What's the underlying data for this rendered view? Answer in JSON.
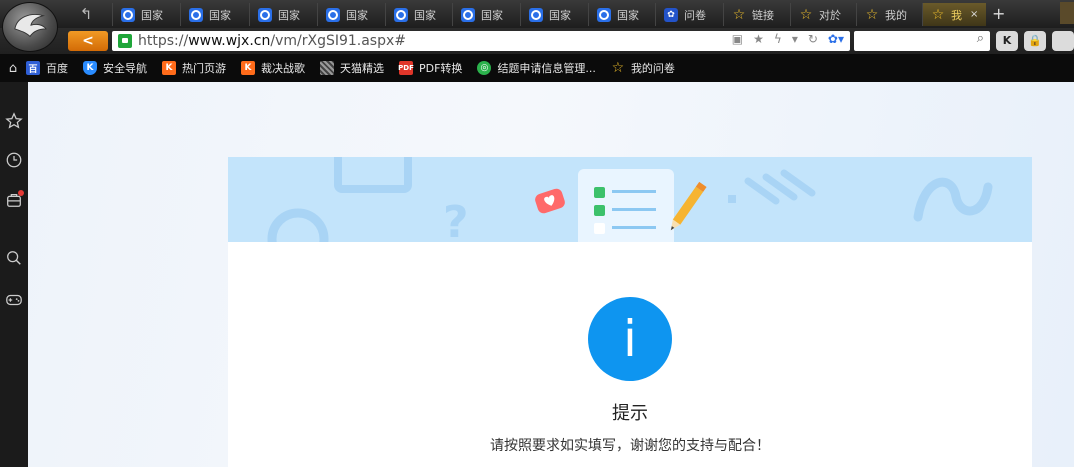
{
  "browser": {
    "tabs": [
      {
        "label": "国家",
        "icon": "blue-eye"
      },
      {
        "label": "国家",
        "icon": "blue-eye"
      },
      {
        "label": "国家",
        "icon": "blue-eye"
      },
      {
        "label": "国家",
        "icon": "blue-eye"
      },
      {
        "label": "国家",
        "icon": "blue-eye"
      },
      {
        "label": "国家",
        "icon": "blue-eye"
      },
      {
        "label": "国家",
        "icon": "blue-eye"
      },
      {
        "label": "国家",
        "icon": "blue-eye"
      },
      {
        "label": "问卷",
        "icon": "paw"
      },
      {
        "label": "链接",
        "icon": "star"
      },
      {
        "label": "对於",
        "icon": "star"
      },
      {
        "label": "我的",
        "icon": "star"
      },
      {
        "label": "我",
        "icon": "star",
        "active": true
      }
    ],
    "active_tab_close": "×",
    "new_tab_label": "+",
    "back_top_glyph": "↰",
    "back_glyph": "<",
    "url_prefix": "https://",
    "url_host": "www.wjx.cn",
    "url_path": "/vm/rXgSI91.aspx#",
    "right_buttons": [
      "K",
      "🔒"
    ]
  },
  "bookmarks": [
    {
      "label": "百度",
      "icon": "baidu",
      "glyph": "百"
    },
    {
      "label": "安全导航",
      "icon": "shield",
      "glyph": "K"
    },
    {
      "label": "热门页游",
      "icon": "kk",
      "glyph": "K"
    },
    {
      "label": "裁决战歌",
      "icon": "kk",
      "glyph": "K"
    },
    {
      "label": "天猫精选",
      "icon": "tmall",
      "glyph": ""
    },
    {
      "label": "PDF转换",
      "icon": "pdf",
      "glyph": "PDF"
    },
    {
      "label": "结题申请信息管理...",
      "icon": "green",
      "glyph": "◎"
    },
    {
      "label": "我的问卷",
      "icon": "star2",
      "glyph": "☆"
    }
  ],
  "page": {
    "title": "提示",
    "message": "请按照要求如实填写，谢谢您的支持与配合！",
    "info_icon_letter": "i"
  },
  "colors": {
    "accent_blue": "#0e95f0",
    "banner_blue": "#c3e4fb",
    "back_orange": "#e8820f"
  }
}
